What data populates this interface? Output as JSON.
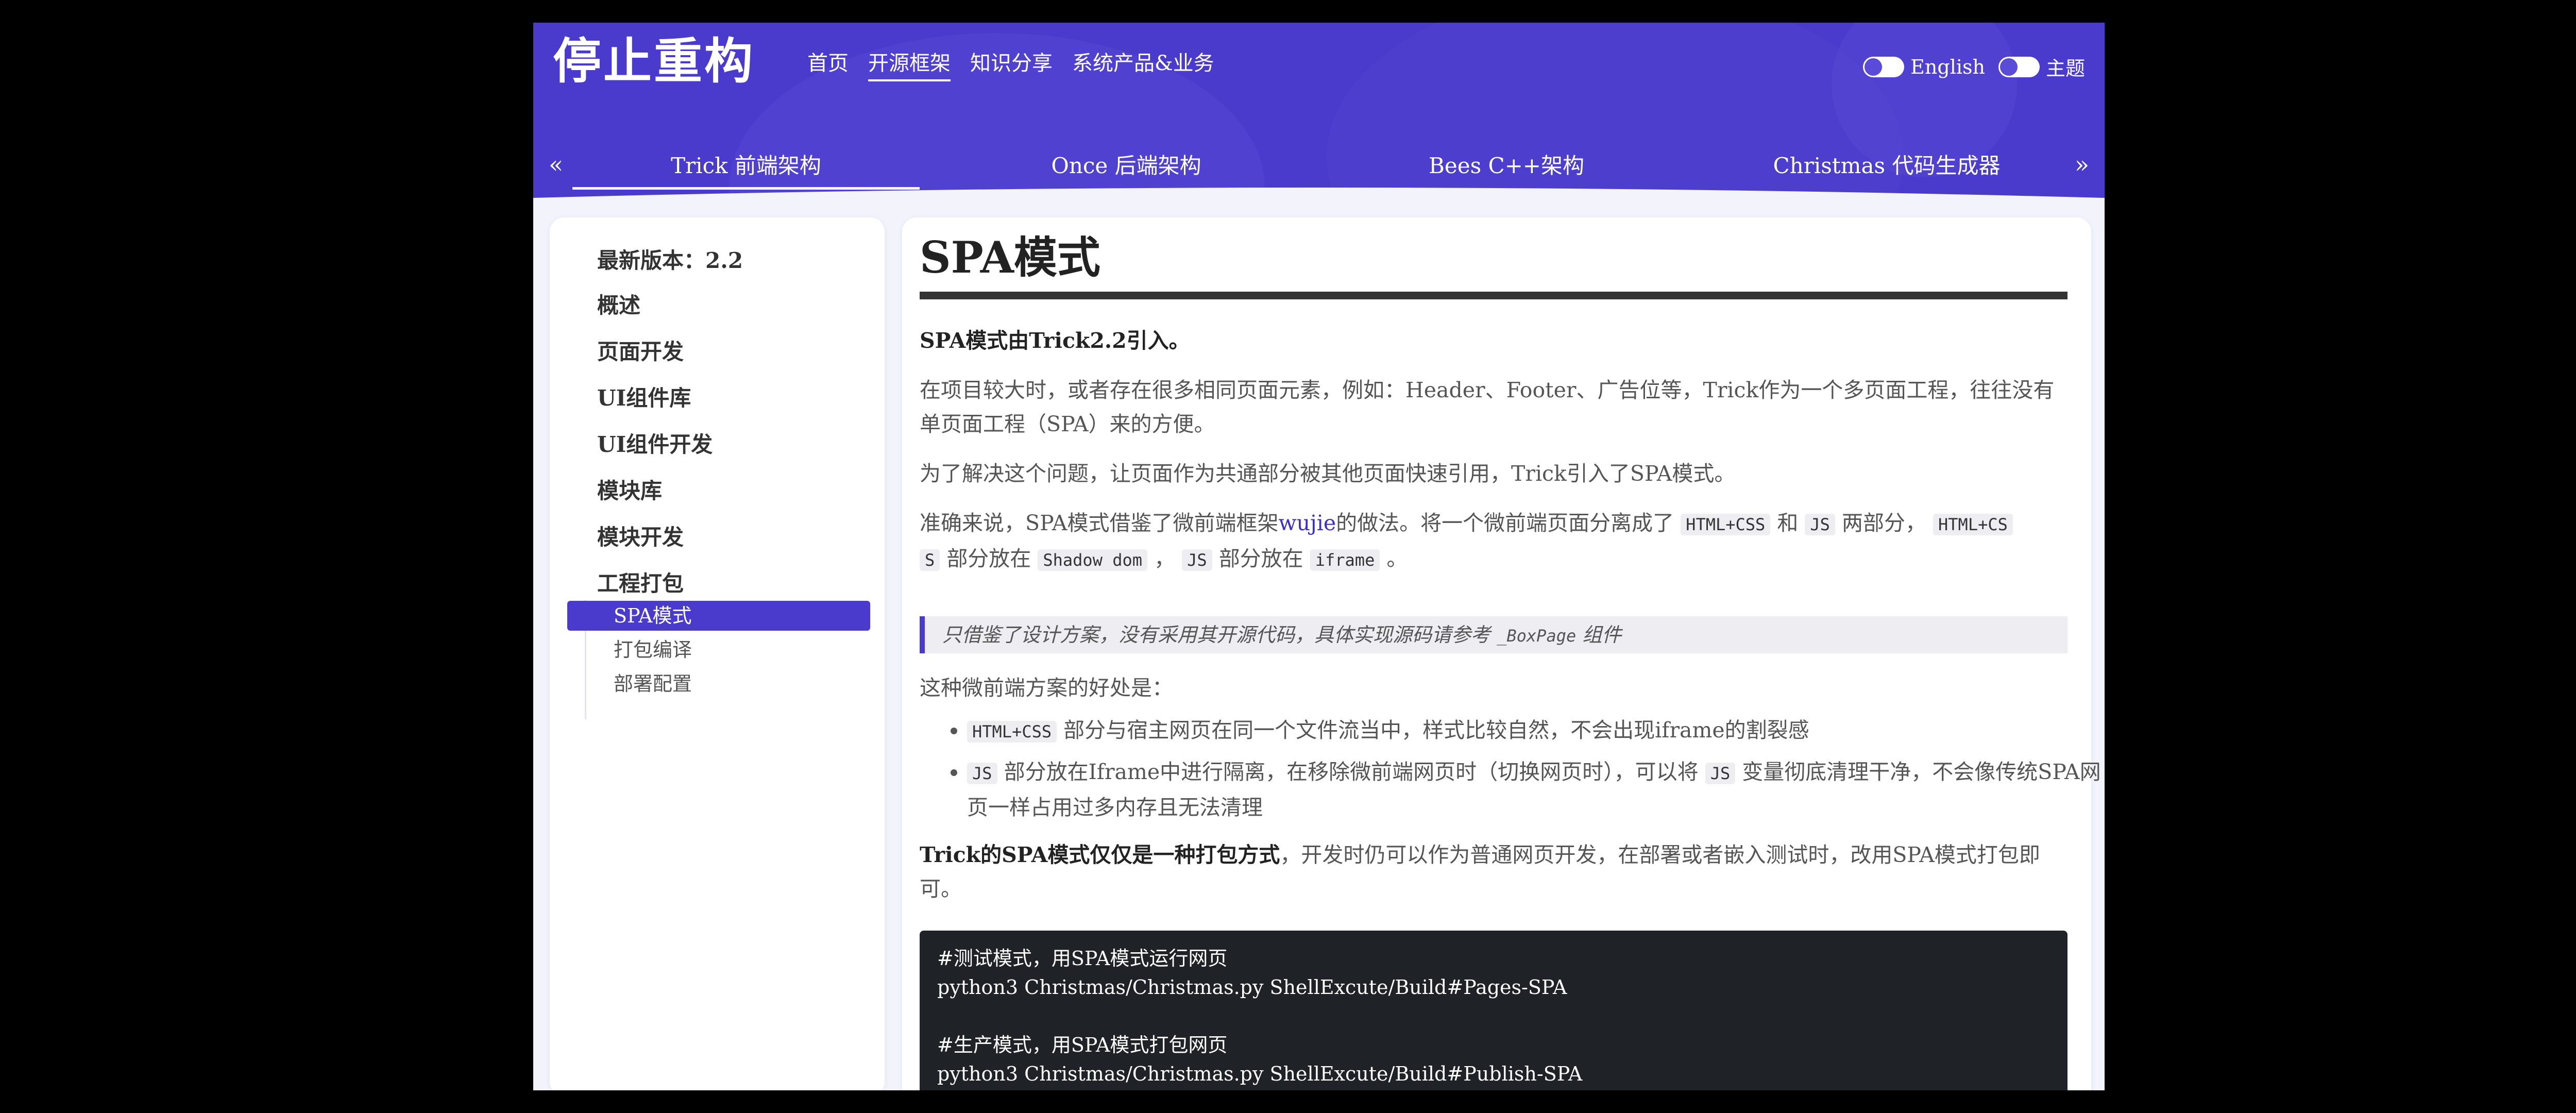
{
  "brand": "停止重构",
  "topnav": [
    "首页",
    "开源框架",
    "知识分享",
    "系统产品&业务"
  ],
  "toggles": {
    "language": "English",
    "theme": "主题"
  },
  "subnav": {
    "prev": "«",
    "next": "»",
    "items": [
      "Trick 前端架构",
      "Once 后端架构",
      "Bees C++架构",
      "Christmas 代码生成器"
    ]
  },
  "sidebar": {
    "version_label": "最新版本：",
    "version": "2.2",
    "items": [
      "概述",
      "页面开发",
      "UI组件库",
      "UI组件开发",
      "模块库",
      "模块开发",
      "工程打包"
    ],
    "sub_items": [
      "SPA模式",
      "打包编译",
      "部署配置"
    ]
  },
  "article": {
    "title": "SPA模式",
    "intro": "SPA模式由Trick2.2引入。",
    "p1": "在项目较大时，或者存在很多相同页面元素，例如：Header、Footer、广告位等，Trick作为一个多页面工程，往往没有单页面工程（SPA）来的方便。",
    "p2": "为了解决这个问题，让页面作为共通部分被其他页面快速引用，Trick引入了SPA模式。",
    "p3": {
      "t1": "准确来说，SPA模式借鉴了微前端框架",
      "link": "wujie",
      "t2": "的做法。将一个微前端页面分离成了",
      "c1": "HTML+CSS",
      "t3": "和",
      "c2": "JS",
      "t4": "两部分，",
      "c3a": "HTML+CS",
      "c3b": "S",
      "t5": "部分放在",
      "c4": "Shadow dom",
      "t6": "，",
      "c5": "JS",
      "t7": "部分放在",
      "c6": "iframe",
      "t8": "。"
    },
    "quote": {
      "text": "只借鉴了设计方案，没有采用其开源代码，具体实现源码请参考",
      "code": "_BoxPage",
      "suffix": "组件"
    },
    "benefits_intro": "这种微前端方案的好处是：",
    "benefit1": {
      "code": "HTML+CSS",
      "text": "部分与宿主网页在同一个文件流当中，样式比较自然，不会出现iframe的割裂感"
    },
    "benefit2": {
      "code1": "JS",
      "text1": "部分放在Iframe中进行隔离，在移除微前端网页时（切换网页时），可以将",
      "code2": "JS",
      "text2": "变量彻底清理干净，不会像传统SPA网页一样占用过多内存且无法清理"
    },
    "conclusion_bold": "Trick的SPA模式仅仅是一种打包方式",
    "conclusion": "，开发时仍可以作为普通网页开发，在部署或者嵌入测试时，改用SPA模式打包即可。",
    "code_lines": [
      "#测试模式，用SPA模式运行网页",
      "python3 Christmas/Christmas.py ShellExcute/Build#Pages-SPA",
      "",
      "#生产模式，用SPA模式打包网页",
      "python3 Christmas/Christmas.py ShellExcute/Build#Publish-SPA"
    ]
  },
  "colors": {
    "accent": "#4a3bcc",
    "page_bg": "#f2f3fb",
    "code_bg": "#1f2226"
  }
}
